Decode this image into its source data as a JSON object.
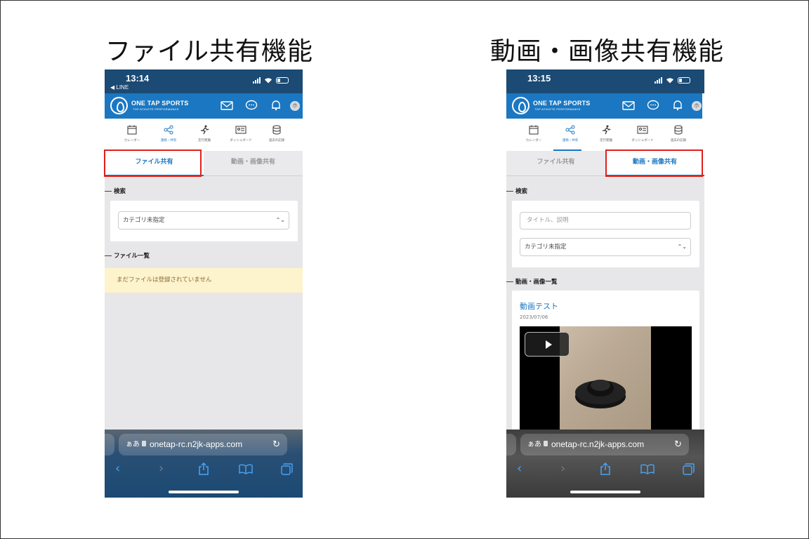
{
  "captions": {
    "left": "ファイル共有機能",
    "right": "動画・画像共有機能"
  },
  "left_phone": {
    "status": {
      "time": "13:14",
      "back_app": "◀ LINE"
    },
    "header": {
      "logo_text": "ONE TAP SPORTS",
      "logo_sub": "TOP ATHLETE PERFORMANCE",
      "avatar": "ホ"
    },
    "tabs": [
      {
        "label": "カレンダー",
        "icon": "calendar-icon"
      },
      {
        "label": "連絡・共有",
        "icon": "share-icon"
      },
      {
        "label": "走行距離",
        "icon": "runner-icon"
      },
      {
        "label": "ダッシュボード",
        "icon": "dashboard-icon"
      },
      {
        "label": "過去の記録",
        "icon": "database-icon"
      }
    ],
    "subtabs": {
      "file_share": "ファイル共有",
      "media_share": "動画・画像共有"
    },
    "search_heading": "検索",
    "category_select": "カテゴリ未指定",
    "list_heading": "ファイル一覧",
    "empty_message": "まだファイルは登録されていません",
    "safari": {
      "aa": "ぁあ",
      "url": "onetap-rc.n2jk-apps.com"
    }
  },
  "right_phone": {
    "status": {
      "time": "13:15"
    },
    "header": {
      "logo_text": "ONE TAP SPORTS",
      "logo_sub": "TOP ATHLETE PERFORMANCE",
      "avatar": "ホ"
    },
    "tabs": [
      {
        "label": "カレンダー",
        "icon": "calendar-icon"
      },
      {
        "label": "連絡・共有",
        "icon": "share-icon"
      },
      {
        "label": "走行距離",
        "icon": "runner-icon"
      },
      {
        "label": "ダッシュボード",
        "icon": "dashboard-icon"
      },
      {
        "label": "過去の記録",
        "icon": "database-icon"
      }
    ],
    "subtabs": {
      "file_share": "ファイル共有",
      "media_share": "動画・画像共有"
    },
    "search_heading": "検索",
    "search_placeholder": "タイトル、説明",
    "category_select": "カテゴリ未指定",
    "list_heading": "動画・画像一覧",
    "video": {
      "title": "動画テスト",
      "date": "2023/07/06"
    },
    "safari": {
      "aa": "ぁあ",
      "url": "onetap-rc.n2jk-apps.com"
    }
  },
  "colors": {
    "brand_dark": "#1b4a74",
    "brand": "#1b77c1",
    "highlight": "#e0201b",
    "notice_bg": "#fdf3cd"
  }
}
